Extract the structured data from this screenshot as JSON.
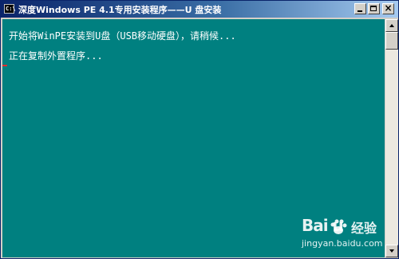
{
  "window": {
    "title": "深度Windows PE 4.1专用安装程序——U 盘安装",
    "icon_label": "C:\\"
  },
  "controls": {
    "minimize_icon": "minimize-icon",
    "maximize_icon": "maximize-icon",
    "close_icon": "close-icon",
    "close_glyph": "×"
  },
  "console": {
    "background": "#008080",
    "text_color": "#ffffff",
    "lines": [
      "开始将WinPE安装到U盘（USB移动硬盘），请稍候...",
      "正在复制外置程序..."
    ]
  },
  "watermark": {
    "logo": "Bai  u",
    "brand_cn": "经验",
    "url": "jingyan.baidu.com"
  }
}
